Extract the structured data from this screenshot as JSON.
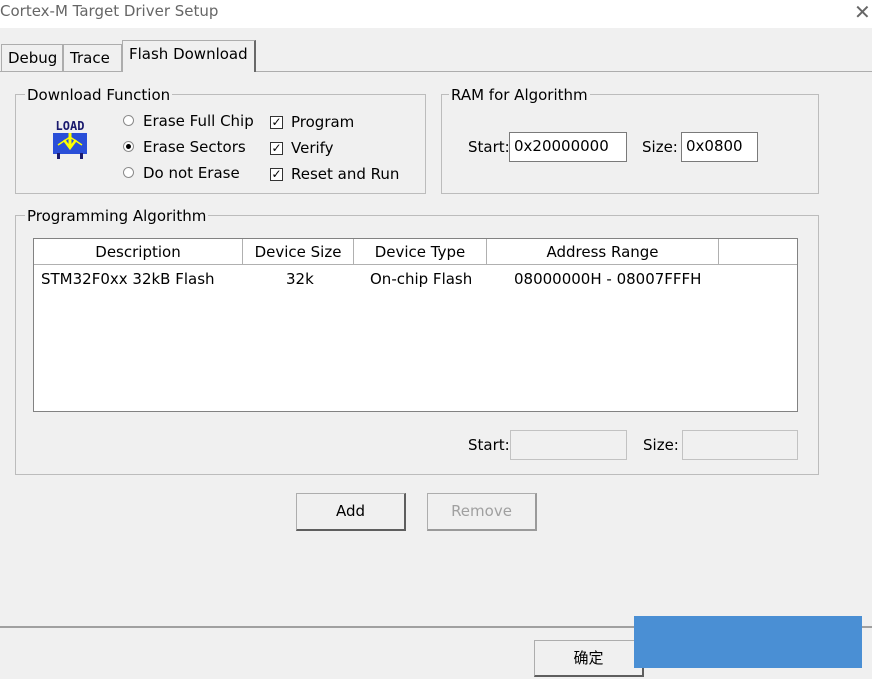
{
  "window": {
    "title": "Cortex-M Target Driver Setup",
    "close_glyph": "✕"
  },
  "tabs": [
    {
      "label": "Debug"
    },
    {
      "label": "Trace"
    },
    {
      "label": "Flash Download",
      "active": true
    }
  ],
  "download_function": {
    "legend": "Download Function",
    "icon_text": "LOAD",
    "radios": [
      {
        "label": "Erase Full Chip",
        "checked": false
      },
      {
        "label": "Erase Sectors",
        "checked": true
      },
      {
        "label": "Do not Erase",
        "checked": false
      }
    ],
    "checks": [
      {
        "label": "Program",
        "checked": true
      },
      {
        "label": "Verify",
        "checked": true
      },
      {
        "label": "Reset and Run",
        "checked": true
      }
    ]
  },
  "ram": {
    "legend": "RAM for Algorithm",
    "start_label": "Start:",
    "start_value": "0x20000000",
    "size_label": "Size:",
    "size_value": "0x0800"
  },
  "programming": {
    "legend": "Programming Algorithm",
    "columns": [
      "Description",
      "Device Size",
      "Device Type",
      "Address Range"
    ],
    "rows": [
      [
        "STM32F0xx 32kB Flash",
        "32k",
        "On-chip Flash",
        "08000000H - 08007FFFH"
      ]
    ],
    "start_label": "Start:",
    "start_value": "",
    "size_label": "Size:",
    "size_value": ""
  },
  "buttons": {
    "add": "Add",
    "remove": "Remove",
    "ok": "确定"
  },
  "colors": {
    "accent": "#4a8fd4",
    "check_mark": "#000000"
  }
}
